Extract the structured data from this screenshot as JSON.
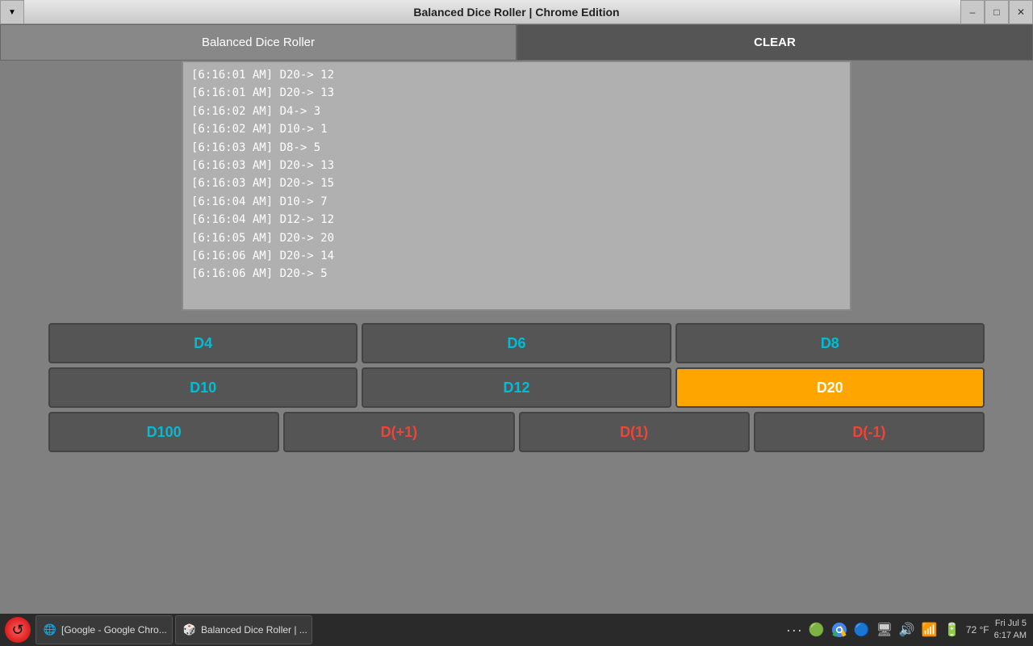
{
  "titleBar": {
    "title": "Balanced Dice Roller | Chrome Edition"
  },
  "navBar": {
    "mainTab": "Balanced Dice Roller",
    "clearButton": "CLEAR"
  },
  "logLines": [
    "[6:16:01 AM] D20-> 12",
    "[6:16:01 AM] D20-> 13",
    "[6:16:02 AM] D4-> 3",
    "[6:16:02 AM] D10-> 1",
    "[6:16:03 AM] D8-> 5",
    "[6:16:03 AM] D20-> 13",
    "[6:16:03 AM] D20-> 15",
    "[6:16:04 AM] D10-> 7",
    "[6:16:04 AM] D12-> 12",
    "[6:16:05 AM] D20-> 20",
    "[6:16:06 AM] D20-> 14",
    "[6:16:06 AM] D20-> 5"
  ],
  "diceButtons": {
    "row1": [
      {
        "label": "D4",
        "color": "cyan",
        "active": false
      },
      {
        "label": "D6",
        "color": "cyan",
        "active": false
      },
      {
        "label": "D8",
        "color": "cyan",
        "active": false
      }
    ],
    "row2": [
      {
        "label": "D10",
        "color": "cyan",
        "active": false
      },
      {
        "label": "D12",
        "color": "cyan",
        "active": false
      },
      {
        "label": "D20",
        "color": "cyan",
        "active": true
      }
    ],
    "row3": [
      {
        "label": "D100",
        "color": "cyan",
        "active": false
      },
      {
        "label": "D(+1)",
        "color": "red",
        "active": false
      },
      {
        "label": "D(1)",
        "color": "red",
        "active": false
      },
      {
        "label": "D(-1)",
        "color": "red",
        "active": false
      }
    ]
  },
  "taskbar": {
    "apps": [
      {
        "label": "[Google - Google Chro...",
        "icon": "🌐"
      },
      {
        "label": "Balanced Dice Roller | ...",
        "icon": "🎲"
      }
    ],
    "temperature": "72 °F",
    "time": "6:17 AM",
    "date": "Fri Jul  5"
  }
}
